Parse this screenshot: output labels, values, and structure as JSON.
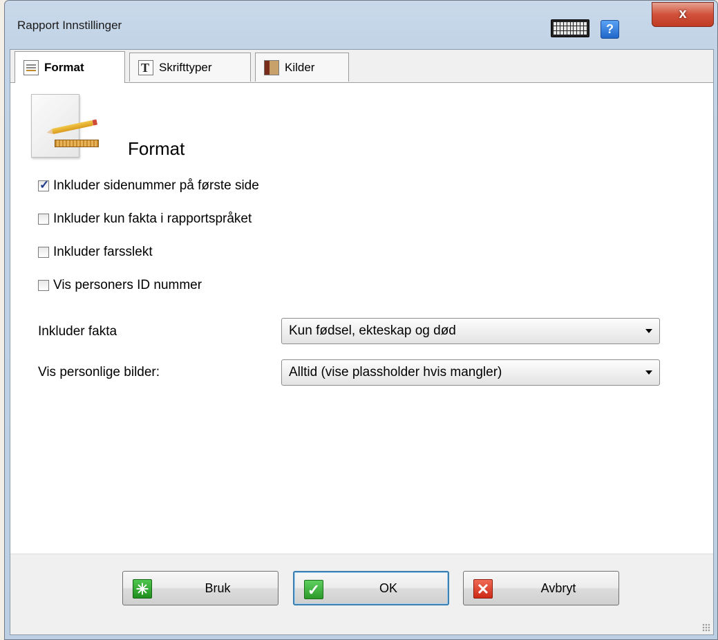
{
  "window": {
    "title": "Rapport Innstillinger",
    "close_label": "x",
    "help_label": "?",
    "accent_close": "#c03b24"
  },
  "tabs": [
    {
      "label": "Format",
      "icon": "document-ruler-icon",
      "active": true
    },
    {
      "label": "Skrifttyper",
      "icon": "font-icon",
      "active": false
    },
    {
      "label": "Kilder",
      "icon": "book-icon",
      "active": false
    }
  ],
  "section": {
    "title": "Format",
    "icon": "format-page-icon"
  },
  "options": [
    {
      "label": "Inkluder sidenummer på første side",
      "checked": true
    },
    {
      "label": "Inkluder kun fakta i rapportspråket",
      "checked": false
    },
    {
      "label": "Inkluder farsslekt",
      "checked": false
    },
    {
      "label": "Vis personers ID nummer",
      "checked": false
    }
  ],
  "fields": {
    "include_facts": {
      "label": "Inkluder fakta",
      "value": "Kun fødsel, ekteskap og død"
    },
    "personal_images": {
      "label": "Vis personlige bilder:",
      "value": "Alltid (vise plassholder hvis mangler)"
    }
  },
  "buttons": {
    "apply": "Bruk",
    "ok": "OK",
    "cancel": "Avbryt"
  }
}
